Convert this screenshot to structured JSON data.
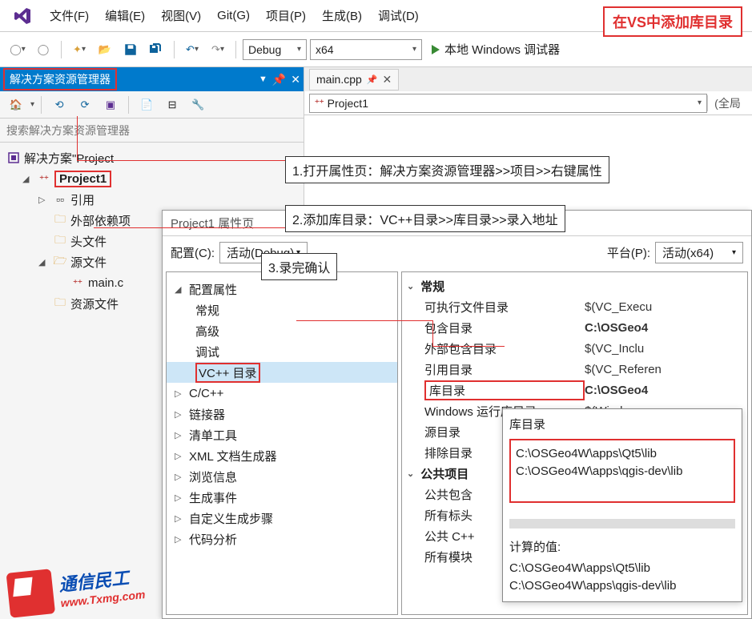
{
  "annotations": {
    "title": "在VS中添加库目录",
    "step1": "1.打开属性页：解决方案资源管理器>>项目>>右键属性",
    "step2": "2.添加库目录：VC++目录>>库目录>>录入地址",
    "step3": "3.录完确认"
  },
  "menu": {
    "file": "文件(F)",
    "edit": "编辑(E)",
    "view": "视图(V)",
    "git": "Git(G)",
    "project": "项目(P)",
    "build": "生成(B)",
    "debug": "调试(D)"
  },
  "toolbar": {
    "config": "Debug",
    "platform": "x64",
    "debugger": "本地 Windows 调试器"
  },
  "solution_explorer": {
    "title": "解决方案资源管理器",
    "search_placeholder": "搜索解决方案资源管理器",
    "solution_label": "解决方案\"Project",
    "project": "Project1",
    "nodes": {
      "references": "引用",
      "external": "外部依赖项",
      "headers": "头文件",
      "sources": "源文件",
      "main_file": "main.c",
      "resources": "资源文件"
    }
  },
  "editor": {
    "tab": "main.cpp",
    "nav_project": "Project1",
    "side_label": "(全局"
  },
  "prop": {
    "title": "Project1 属性页",
    "config_label": "配置(C):",
    "config_value": "活动(Debug)",
    "platform_label": "平台(P):",
    "platform_value": "活动(x64)",
    "tree": {
      "root": "配置属性",
      "general": "常规",
      "advanced": "高级",
      "debug": "调试",
      "vcdirs": "VC++ 目录",
      "ccpp": "C/C++",
      "linker": "链接器",
      "manifest": "清单工具",
      "xml": "XML 文档生成器",
      "browse": "浏览信息",
      "build_events": "生成事件",
      "custom_build": "自定义生成步骤",
      "code_analysis": "代码分析"
    },
    "grid": {
      "sec_general": "常规",
      "exe_dirs": "可执行文件目录",
      "exe_val": "$(VC_Execu",
      "include_dirs": "包含目录",
      "include_val": "C:\\OSGeo4",
      "ext_include": "外部包含目录",
      "ext_include_val": "$(VC_Inclu",
      "ref_dirs": "引用目录",
      "ref_val": "$(VC_Referen",
      "lib_dirs": "库目录",
      "lib_val": "C:\\OSGeo4",
      "win_lib": "Windows 运行库目录",
      "win_lib_val": "$(Windows",
      "src_dirs": "源目录",
      "exclude_dirs": "排除目录",
      "sec_public": "公共项目",
      "pub_include": "公共包含",
      "pub_all_hdr": "所有标头",
      "pub_cpp": "公共 C++",
      "pub_all_mod": "所有模块"
    }
  },
  "lib_popup": {
    "title": "库目录",
    "paths": [
      "C:\\OSGeo4W\\apps\\Qt5\\lib",
      "C:\\OSGeo4W\\apps\\qgis-dev\\lib"
    ],
    "calc_label": "计算的值:",
    "calc_paths": [
      "C:\\OSGeo4W\\apps\\Qt5\\lib",
      "C:\\OSGeo4W\\apps\\qgis-dev\\lib"
    ]
  },
  "watermark": {
    "cn": "通信民工",
    "url": "www.Txmg.com"
  }
}
